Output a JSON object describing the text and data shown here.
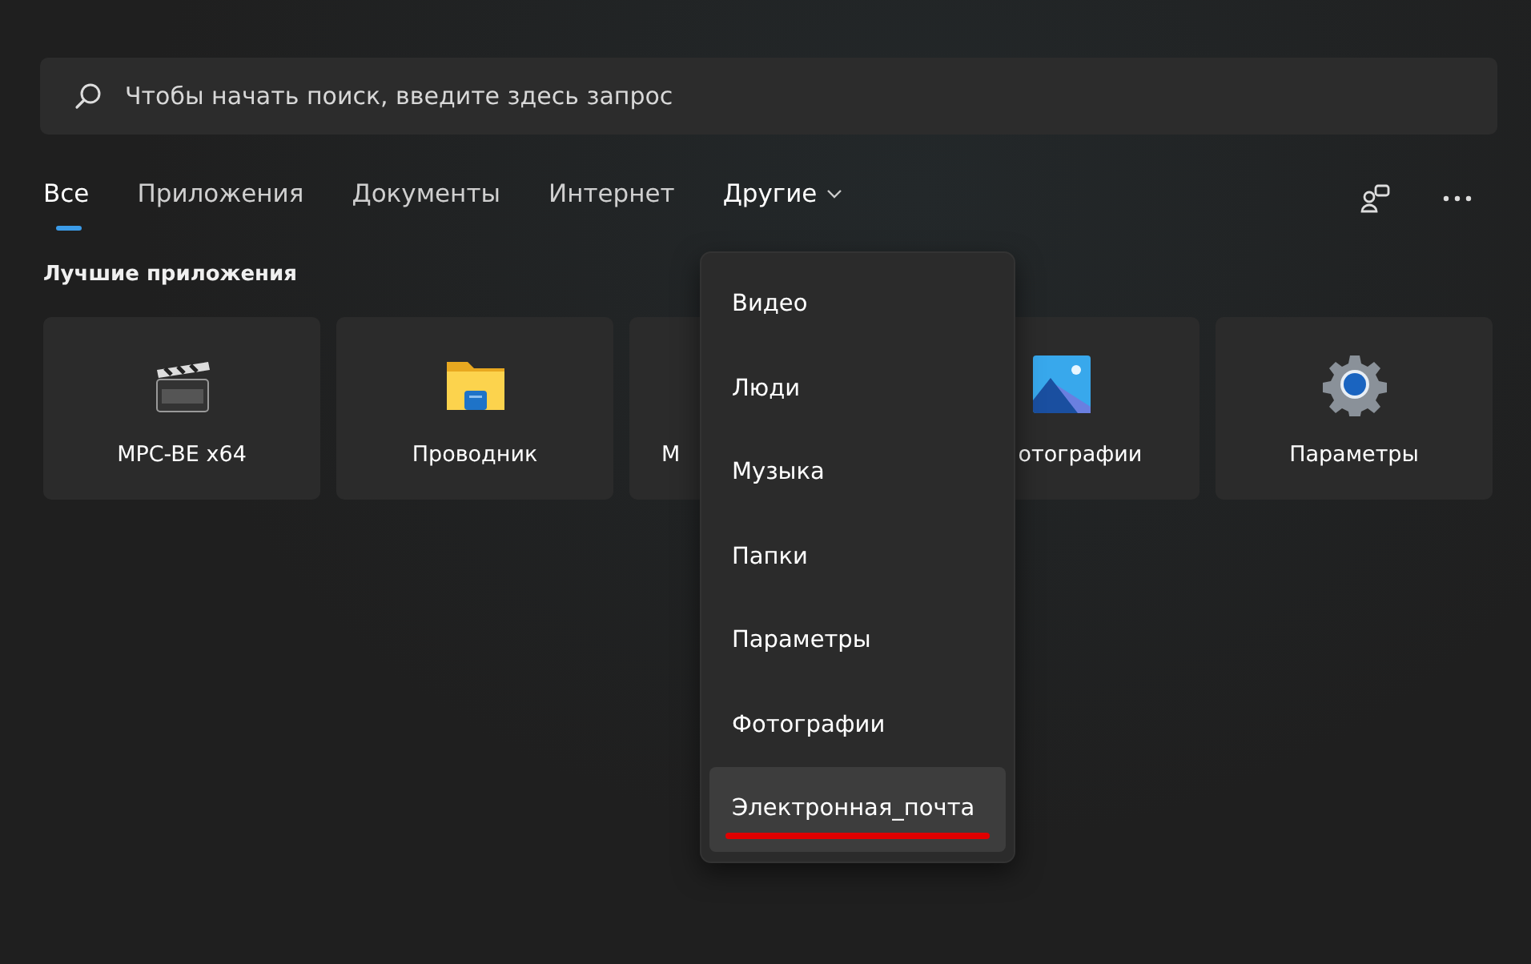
{
  "search": {
    "placeholder": "Чтобы начать поиск, введите здесь запрос"
  },
  "tabs": [
    {
      "label": "Все",
      "selected": true,
      "kind": "tab"
    },
    {
      "label": "Приложения",
      "selected": false,
      "kind": "tab"
    },
    {
      "label": "Документы",
      "selected": false,
      "kind": "tab"
    },
    {
      "label": "Интернет",
      "selected": false,
      "kind": "tab"
    },
    {
      "label": "Другие",
      "kind": "dropdown"
    }
  ],
  "section_title": "Лучшие приложения",
  "apps": [
    {
      "label": "MPC-BE x64",
      "kind": "full"
    },
    {
      "label": "Проводник",
      "kind": "full"
    },
    {
      "label": "М",
      "kind": "edge"
    },
    {
      "label": "отографии",
      "kind": "overlapped"
    },
    {
      "label": "Параметры",
      "kind": "full"
    }
  ],
  "menu": [
    {
      "label": "Видео",
      "selected": false,
      "underlined": false
    },
    {
      "label": "Люди",
      "selected": false,
      "underlined": false
    },
    {
      "label": "Музыка",
      "selected": false,
      "underlined": false
    },
    {
      "label": "Папки",
      "selected": false,
      "underlined": false
    },
    {
      "label": "Параметры",
      "selected": false,
      "underlined": false
    },
    {
      "label": "Фотографии",
      "selected": false,
      "underlined": false
    },
    {
      "label": "Электронная_почта",
      "selected": true,
      "underlined": true
    }
  ]
}
